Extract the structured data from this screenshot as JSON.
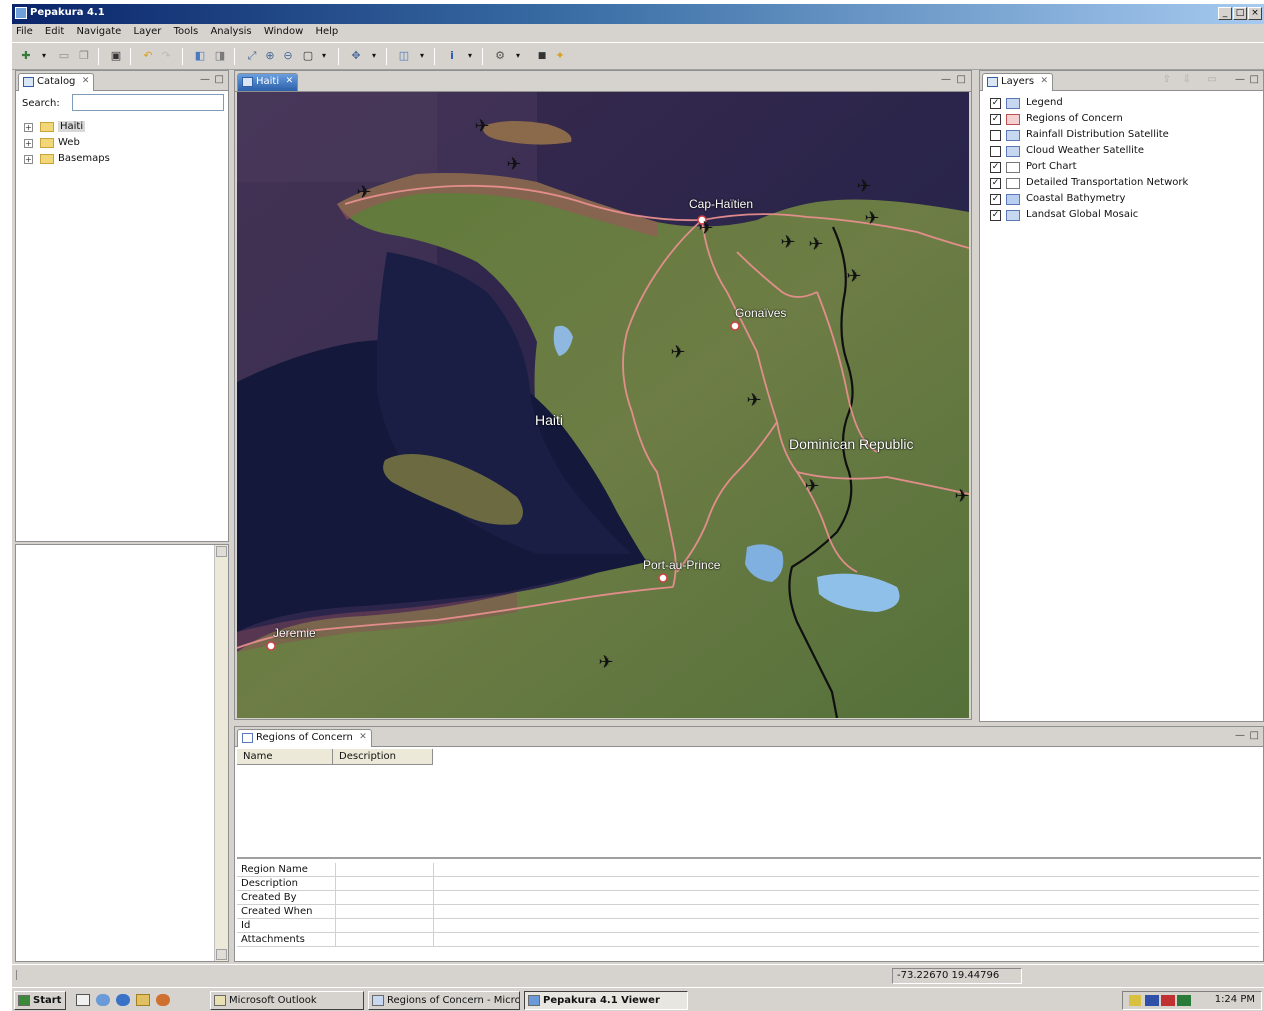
{
  "window": {
    "title": "Pepakura 4.1",
    "min": "_",
    "max": "□",
    "close": "×"
  },
  "menu": [
    "File",
    "Edit",
    "Navigate",
    "Layer",
    "Tools",
    "Analysis",
    "Window",
    "Help"
  ],
  "catalog": {
    "tab": "Catalog",
    "search_label": "Search:",
    "search_value": "",
    "items": [
      {
        "label": "Haiti",
        "selected": true
      },
      {
        "label": "Web",
        "selected": false
      },
      {
        "label": "Basemaps",
        "selected": false
      }
    ]
  },
  "map": {
    "tab": "Haiti",
    "labels": {
      "cap_haitien": "Cap-Haïtien",
      "gonaives": "Gonaïves",
      "haiti": "Haiti",
      "dominican": "Dominican Republic",
      "port_au_prince": "Port-au-Prince",
      "jeremie": "Jeremie"
    }
  },
  "layers": {
    "tab": "Layers",
    "items": [
      {
        "label": "Legend",
        "checked": true
      },
      {
        "label": "Regions of Concern",
        "checked": true
      },
      {
        "label": "Rainfall Distribution Satellite",
        "checked": false
      },
      {
        "label": "Cloud Weather Satellite",
        "checked": false
      },
      {
        "label": "Port Chart",
        "checked": true
      },
      {
        "label": "Detailed Transportation Network",
        "checked": true
      },
      {
        "label": "Coastal Bathymetry",
        "checked": true
      },
      {
        "label": "Landsat Global Mosaic",
        "checked": true
      }
    ]
  },
  "attributes": {
    "tab": "Regions of Concern",
    "columns": [
      "Name",
      "Description"
    ],
    "properties": [
      "Region Name",
      "Description",
      "Created By",
      "Created When",
      "Id",
      "Attachments"
    ]
  },
  "status": {
    "coords": "-73.22670  19.44796"
  },
  "taskbar": {
    "start": "Start",
    "buttons": [
      {
        "label": "Microsoft Outlook",
        "active": false
      },
      {
        "label": "Regions of Concern - Microsoft Word",
        "active": false
      },
      {
        "label": "Pepakura 4.1 Viewer",
        "active": true
      }
    ],
    "clock": "1:24 PM"
  },
  "colors": {
    "title_start": "#0a246a",
    "title_end": "#a6caf0",
    "active_tab": "#2b5fa8",
    "road": "#e88f8f",
    "border_line": "#111111"
  }
}
